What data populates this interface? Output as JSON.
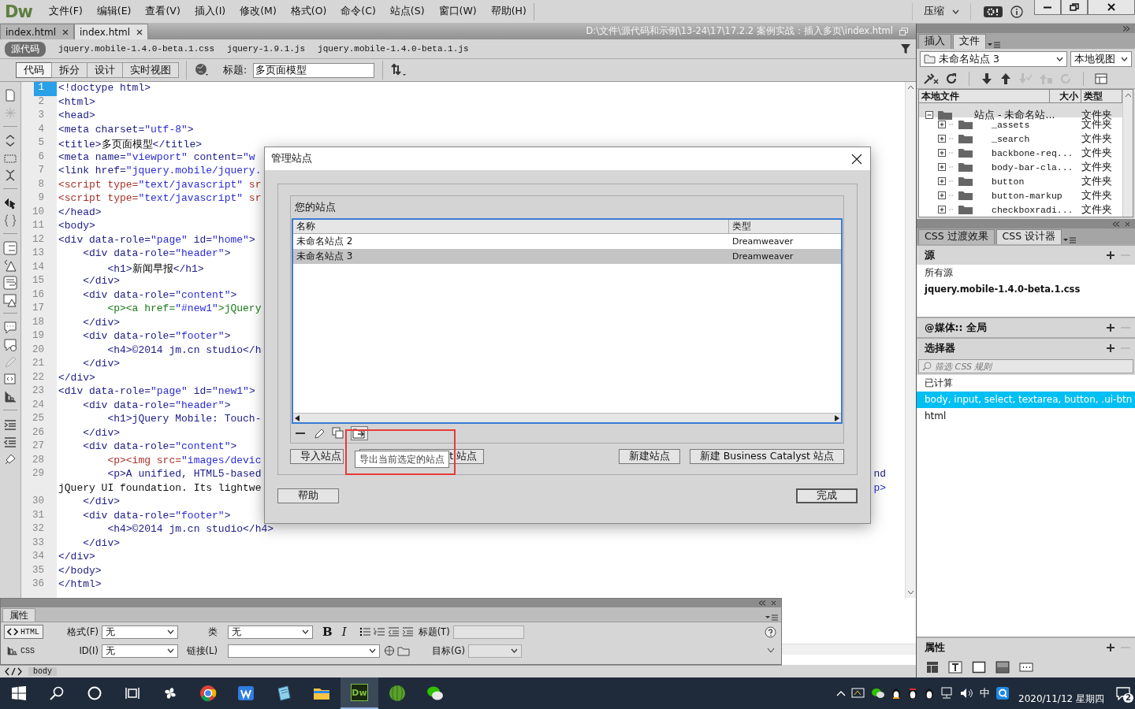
{
  "menubar": {
    "logo": "Dw",
    "menus": [
      "文件(F)",
      "编辑(E)",
      "查看(V)",
      "插入(I)",
      "修改(M)",
      "格式(O)",
      "命令(C)",
      "站点(S)",
      "窗口(W)",
      "帮助(H)"
    ],
    "workspace": "压缩"
  },
  "doc_tabs": [
    {
      "label": "index.html",
      "selected": false
    },
    {
      "label": "index.html",
      "selected": true
    }
  ],
  "doc_path": "D:\\文件\\源代码和示例\\13-24\\17\\17.2.2  案例实战：插入多页\\index.html",
  "related_files": [
    {
      "label": "源代码",
      "selected": true
    },
    {
      "label": "jquery.mobile-1.4.0-beta.1.css",
      "selected": false
    },
    {
      "label": "jquery-1.9.1.js",
      "selected": false
    },
    {
      "label": "jquery.mobile-1.4.0-beta.1.js",
      "selected": false
    }
  ],
  "view_buttons": [
    {
      "label": "代码",
      "selected": true
    },
    {
      "label": "拆分",
      "selected": false
    },
    {
      "label": "设计",
      "selected": false
    },
    {
      "label": "实时视图",
      "selected": false
    }
  ],
  "title_field": {
    "label": "标题:",
    "value": "多页面模型"
  },
  "code_lines": [
    {
      "number": "1",
      "text": "<!doctype html>",
      "kind": "tag",
      "current": true
    },
    {
      "number": "2",
      "text": "<html>",
      "kind": "tag",
      "current": false
    },
    {
      "number": "3",
      "text": "<head>",
      "kind": "tag",
      "current": false
    },
    {
      "number": "4",
      "text": "<meta charset=\"utf-8\">",
      "kind": "tag",
      "current": false
    },
    {
      "number": "5",
      "text": "<title>多页面模型</title>",
      "kind": "tag",
      "current": false
    },
    {
      "number": "6",
      "text": "<meta name=\"viewport\" content=\"w",
      "kind": "tag",
      "current": false
    },
    {
      "number": "7",
      "text": "<link href=\"jquery.mobile/jquery.",
      "kind": "tag",
      "current": false
    },
    {
      "number": "8",
      "text": "<script type=\"text/javascript\" sr",
      "kind": "script",
      "current": false
    },
    {
      "number": "9",
      "text": "<script type=\"text/javascript\" sr",
      "kind": "script",
      "current": false
    },
    {
      "number": "10",
      "text": "</head>",
      "kind": "tag",
      "current": false
    },
    {
      "number": "11",
      "text": "<body>",
      "kind": "tag",
      "current": false
    },
    {
      "number": "12",
      "text": "<div data-role=\"page\" id=\"home\">",
      "kind": "tag",
      "current": false
    },
    {
      "number": "13",
      "text": "    <div data-role=\"header\">",
      "kind": "tag",
      "current": false
    },
    {
      "number": "14",
      "text": "        <h1>新闻早报</h1>",
      "kind": "tag",
      "current": false
    },
    {
      "number": "15",
      "text": "    </div>",
      "kind": "tag",
      "current": false
    },
    {
      "number": "16",
      "text": "    <div data-role=\"content\">",
      "kind": "tag",
      "current": false
    },
    {
      "number": "17",
      "text": "        <p><a href=\"#new1\">jQuery",
      "kind": "link",
      "current": false
    },
    {
      "number": "18",
      "text": "    </div>",
      "kind": "tag",
      "current": false
    },
    {
      "number": "19",
      "text": "    <div data-role=\"footer\">",
      "kind": "tag",
      "current": false
    },
    {
      "number": "20",
      "text": "        <h4>©2014 jm.cn studio</h",
      "kind": "tag",
      "current": false
    },
    {
      "number": "21",
      "text": "    </div>",
      "kind": "tag",
      "current": false
    },
    {
      "number": "22",
      "text": "</div>",
      "kind": "tag",
      "current": false
    },
    {
      "number": "23",
      "text": "<div data-role=\"page\" id=\"new1\">",
      "kind": "tag",
      "current": false
    },
    {
      "number": "24",
      "text": "    <div data-role=\"header\">",
      "kind": "tag",
      "current": false
    },
    {
      "number": "25",
      "text": "        <h1>jQuery Mobile: Touch-",
      "kind": "tag",
      "current": false
    },
    {
      "number": "26",
      "text": "    </div>",
      "kind": "tag",
      "current": false
    },
    {
      "number": "27",
      "text": "    <div data-role=\"content\">",
      "kind": "tag",
      "current": false
    },
    {
      "number": "28",
      "text": "        <p><img src=\"images/devic",
      "kind": "img",
      "current": false
    },
    {
      "number": "29",
      "text": "        <p>A unified, HTML5-based",
      "kind": "tag",
      "current": false,
      "tail": "nd",
      "wrap": "jQuery UI foundation. Its lightwe",
      "wrap_tail": "p>"
    },
    {
      "number": "30",
      "text": "    </div>",
      "kind": "tag",
      "current": false
    },
    {
      "number": "31",
      "text": "    <div data-role=\"footer\">",
      "kind": "tag",
      "current": false
    },
    {
      "number": "32",
      "text": "        <h4>©2014 jm.cn studio</h4>",
      "kind": "tag",
      "current": false
    },
    {
      "number": "33",
      "text": "    </div>",
      "kind": "tag",
      "current": false
    },
    {
      "number": "34",
      "text": "</div>",
      "kind": "tag",
      "current": false
    },
    {
      "number": "35",
      "text": "</body>",
      "kind": "tag",
      "current": false
    },
    {
      "number": "36",
      "text": "</html>",
      "kind": "tag",
      "current": false
    }
  ],
  "properties_panel": {
    "title": "属性",
    "modes": [
      {
        "label": "HTML",
        "selected": true
      },
      {
        "label": "CSS",
        "selected": false
      }
    ],
    "format": {
      "label": "格式(F)",
      "value": "无"
    },
    "id": {
      "label": "ID(I)",
      "value": "无"
    },
    "class": {
      "label": "类",
      "value": "无"
    },
    "link": {
      "label": "链接(L)"
    },
    "bold": "B",
    "italic": "I",
    "heading": {
      "label": "标题(T)",
      "disabled": true
    },
    "target": {
      "label": "目标(G)",
      "disabled": true
    }
  },
  "tag_selector": [
    "body"
  ],
  "files_panel": {
    "tabs": [
      {
        "label": "插入",
        "selected": false
      },
      {
        "label": "文件",
        "selected": true
      }
    ],
    "site": "未命名站点 3",
    "view": "本地视图",
    "columns": [
      "本地文件",
      "大小",
      "类型"
    ],
    "tree": [
      {
        "name": "站点 - 未命名站...",
        "type": "文件夹",
        "expanded": true,
        "children": [
          {
            "name": "_assets",
            "type": "文件夹",
            "expanded": false
          },
          {
            "name": "_search",
            "type": "文件夹",
            "expanded": false
          },
          {
            "name": "backbone-req...",
            "type": "文件夹",
            "expanded": false
          },
          {
            "name": "body-bar-cla...",
            "type": "文件夹",
            "expanded": false
          },
          {
            "name": "button",
            "type": "文件夹",
            "expanded": false
          },
          {
            "name": "button-markup",
            "type": "文件夹",
            "expanded": false
          },
          {
            "name": "checkboxradi...",
            "type": "文件夹",
            "expanded": false
          }
        ]
      }
    ]
  },
  "css_panel": {
    "tabs": [
      {
        "label": "CSS 过渡效果",
        "selected": false
      },
      {
        "label": "CSS 设计器",
        "selected": true
      }
    ],
    "sources": {
      "title": "源",
      "items": [
        {
          "label": "所有源",
          "bold": false
        },
        {
          "label": "jquery.mobile-1.4.0-beta.1.css",
          "bold": true
        }
      ]
    },
    "media": {
      "title": "@媒体::  全局"
    },
    "selectors": {
      "title": "选择器",
      "placeholder": "筛选 CSS 规则",
      "items": [
        {
          "label": "已计算",
          "selected": false
        },
        {
          "label": "body, input, select, textarea, button, .ui-btn",
          "selected": true
        },
        {
          "label": "html",
          "selected": false
        }
      ]
    },
    "properties": {
      "title": "属性"
    }
  },
  "dialog": {
    "title": "管理站点",
    "group_title": "您的站点",
    "columns": [
      "名称",
      "类型"
    ],
    "rows": [
      {
        "name": "未命名站点 2",
        "type": "Dreamweaver",
        "selected": false
      },
      {
        "name": "未命名站点 3",
        "type": "Dreamweaver",
        "selected": true
      }
    ],
    "tooltip": "导出当前选定的站点",
    "buttons": [
      {
        "label": "导入站点"
      },
      {
        "label": "t 站点"
      },
      {
        "label": "新建站点"
      },
      {
        "label": "新建  Business Catalyst  站点"
      }
    ],
    "help": "帮助",
    "done": "完成"
  },
  "taskbar": {
    "apps": [
      {
        "kind": "pinwheel",
        "active": false
      },
      {
        "kind": "chrome",
        "active": false
      },
      {
        "kind": "wps",
        "active": false
      },
      {
        "kind": "notes",
        "active": false
      },
      {
        "kind": "explorer",
        "active": false
      },
      {
        "kind": "dw",
        "label": "Dw",
        "active": true
      },
      {
        "kind": "melon",
        "active": false
      },
      {
        "kind": "wechat",
        "active": false
      }
    ],
    "input_method": "中",
    "date": "2020/11/12 星期四",
    "notifications": "2"
  }
}
